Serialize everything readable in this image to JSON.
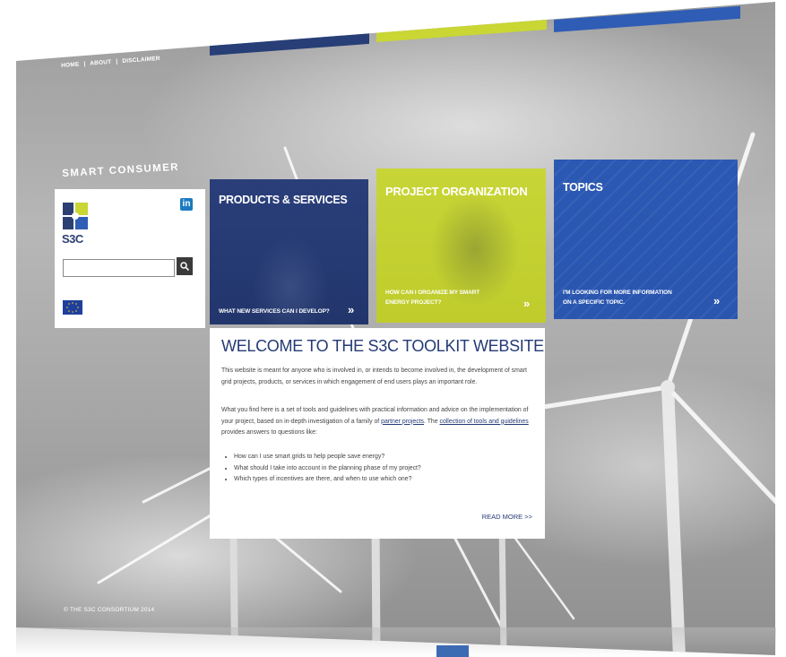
{
  "nav": {
    "home": "HOME",
    "sep1": "|",
    "about": "ABOUT",
    "sep2": "|",
    "disclaimer": "DISCLAIMER"
  },
  "brand": {
    "title": "SMART CONSUMER",
    "logo_text": "S3C",
    "linkedin": "in"
  },
  "search": {
    "value": "",
    "placeholder": ""
  },
  "colors": {
    "navy": "#273e77",
    "lime": "#c9d634",
    "blue": "#2f5db5"
  },
  "tiles": [
    {
      "title": "PRODUCTS & SERVICES",
      "question": "WHAT NEW SERVICES CAN I DEVELOP?",
      "arrow": "»"
    },
    {
      "title": "PROJECT ORGANIZATION",
      "question_line1": "HOW CAN I ORGANIZE MY SMART",
      "question_line2": "ENERGY PROJECT?",
      "arrow": "»"
    },
    {
      "title": "TOPICS",
      "question_line1": "I'M LOOKING FOR MORE INFORMATION",
      "question_line2": "ON A SPECIFIC TOPIC.",
      "arrow": "»"
    }
  ],
  "welcome": {
    "heading": "WELCOME TO THE S3C TOOLKIT WEBSITE",
    "para1": "This website is meant for anyone who is involved in, or intends to become involved in, the development of smart grid projects, products, or services in which engagement of end users plays an important role.",
    "para2_a": "What you find here is a set of tools and guidelines with practical information and advice on the implementation of your project, based on in-depth investigation of a family of ",
    "para2_link1": "partner projects",
    "para2_b": ". The ",
    "para2_link2": "collection of tools and guidelines",
    "para2_c": " provides answers to questions like:",
    "bullets": [
      "How can I use smart grids to help people save energy?",
      "What should I take into account in the planning phase of my project?",
      "Which types of incentives are there, and when to use which one?"
    ],
    "read_more": "READ MORE >>"
  },
  "footer": {
    "copyright": "© THE S3C CONSORTIUM 2014"
  },
  "icons": {
    "search": "search-icon",
    "linkedin": "linkedin-icon",
    "eu": "eu-flag-icon",
    "s3c": "s3c-logo-icon"
  }
}
